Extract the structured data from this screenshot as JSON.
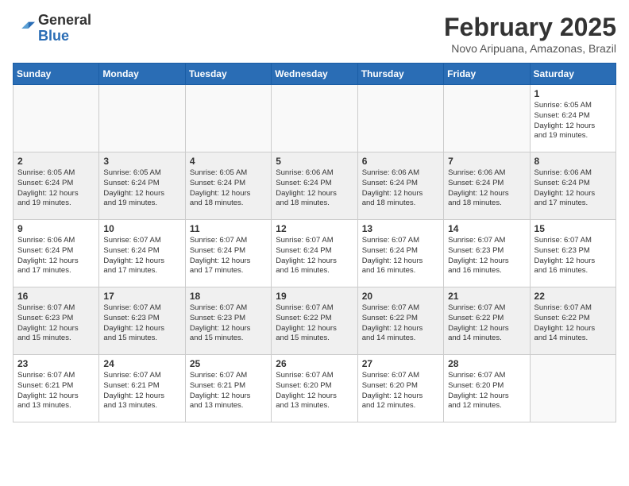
{
  "header": {
    "logo": {
      "line1": "General",
      "line2": "Blue"
    },
    "title": "February 2025",
    "subtitle": "Novo Aripuana, Amazonas, Brazil"
  },
  "weekdays": [
    "Sunday",
    "Monday",
    "Tuesday",
    "Wednesday",
    "Thursday",
    "Friday",
    "Saturday"
  ],
  "weeks": [
    [
      {
        "day": "",
        "info": ""
      },
      {
        "day": "",
        "info": ""
      },
      {
        "day": "",
        "info": ""
      },
      {
        "day": "",
        "info": ""
      },
      {
        "day": "",
        "info": ""
      },
      {
        "day": "",
        "info": ""
      },
      {
        "day": "1",
        "info": "Sunrise: 6:05 AM\nSunset: 6:24 PM\nDaylight: 12 hours\nand 19 minutes."
      }
    ],
    [
      {
        "day": "2",
        "info": "Sunrise: 6:05 AM\nSunset: 6:24 PM\nDaylight: 12 hours\nand 19 minutes."
      },
      {
        "day": "3",
        "info": "Sunrise: 6:05 AM\nSunset: 6:24 PM\nDaylight: 12 hours\nand 19 minutes."
      },
      {
        "day": "4",
        "info": "Sunrise: 6:05 AM\nSunset: 6:24 PM\nDaylight: 12 hours\nand 18 minutes."
      },
      {
        "day": "5",
        "info": "Sunrise: 6:06 AM\nSunset: 6:24 PM\nDaylight: 12 hours\nand 18 minutes."
      },
      {
        "day": "6",
        "info": "Sunrise: 6:06 AM\nSunset: 6:24 PM\nDaylight: 12 hours\nand 18 minutes."
      },
      {
        "day": "7",
        "info": "Sunrise: 6:06 AM\nSunset: 6:24 PM\nDaylight: 12 hours\nand 18 minutes."
      },
      {
        "day": "8",
        "info": "Sunrise: 6:06 AM\nSunset: 6:24 PM\nDaylight: 12 hours\nand 17 minutes."
      }
    ],
    [
      {
        "day": "9",
        "info": "Sunrise: 6:06 AM\nSunset: 6:24 PM\nDaylight: 12 hours\nand 17 minutes."
      },
      {
        "day": "10",
        "info": "Sunrise: 6:07 AM\nSunset: 6:24 PM\nDaylight: 12 hours\nand 17 minutes."
      },
      {
        "day": "11",
        "info": "Sunrise: 6:07 AM\nSunset: 6:24 PM\nDaylight: 12 hours\nand 17 minutes."
      },
      {
        "day": "12",
        "info": "Sunrise: 6:07 AM\nSunset: 6:24 PM\nDaylight: 12 hours\nand 16 minutes."
      },
      {
        "day": "13",
        "info": "Sunrise: 6:07 AM\nSunset: 6:24 PM\nDaylight: 12 hours\nand 16 minutes."
      },
      {
        "day": "14",
        "info": "Sunrise: 6:07 AM\nSunset: 6:23 PM\nDaylight: 12 hours\nand 16 minutes."
      },
      {
        "day": "15",
        "info": "Sunrise: 6:07 AM\nSunset: 6:23 PM\nDaylight: 12 hours\nand 16 minutes."
      }
    ],
    [
      {
        "day": "16",
        "info": "Sunrise: 6:07 AM\nSunset: 6:23 PM\nDaylight: 12 hours\nand 15 minutes."
      },
      {
        "day": "17",
        "info": "Sunrise: 6:07 AM\nSunset: 6:23 PM\nDaylight: 12 hours\nand 15 minutes."
      },
      {
        "day": "18",
        "info": "Sunrise: 6:07 AM\nSunset: 6:23 PM\nDaylight: 12 hours\nand 15 minutes."
      },
      {
        "day": "19",
        "info": "Sunrise: 6:07 AM\nSunset: 6:22 PM\nDaylight: 12 hours\nand 15 minutes."
      },
      {
        "day": "20",
        "info": "Sunrise: 6:07 AM\nSunset: 6:22 PM\nDaylight: 12 hours\nand 14 minutes."
      },
      {
        "day": "21",
        "info": "Sunrise: 6:07 AM\nSunset: 6:22 PM\nDaylight: 12 hours\nand 14 minutes."
      },
      {
        "day": "22",
        "info": "Sunrise: 6:07 AM\nSunset: 6:22 PM\nDaylight: 12 hours\nand 14 minutes."
      }
    ],
    [
      {
        "day": "23",
        "info": "Sunrise: 6:07 AM\nSunset: 6:21 PM\nDaylight: 12 hours\nand 13 minutes."
      },
      {
        "day": "24",
        "info": "Sunrise: 6:07 AM\nSunset: 6:21 PM\nDaylight: 12 hours\nand 13 minutes."
      },
      {
        "day": "25",
        "info": "Sunrise: 6:07 AM\nSunset: 6:21 PM\nDaylight: 12 hours\nand 13 minutes."
      },
      {
        "day": "26",
        "info": "Sunrise: 6:07 AM\nSunset: 6:20 PM\nDaylight: 12 hours\nand 13 minutes."
      },
      {
        "day": "27",
        "info": "Sunrise: 6:07 AM\nSunset: 6:20 PM\nDaylight: 12 hours\nand 12 minutes."
      },
      {
        "day": "28",
        "info": "Sunrise: 6:07 AM\nSunset: 6:20 PM\nDaylight: 12 hours\nand 12 minutes."
      },
      {
        "day": "",
        "info": ""
      }
    ]
  ],
  "shaded_rows": [
    1,
    3
  ]
}
